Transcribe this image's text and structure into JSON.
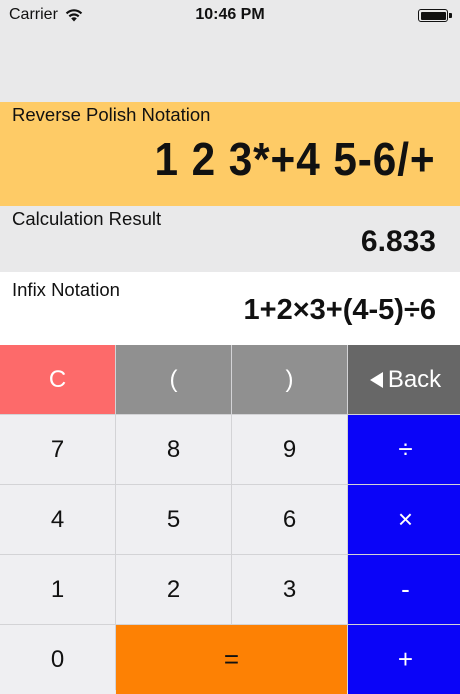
{
  "status_bar": {
    "carrier": "Carrier",
    "time": "10:46 PM",
    "wifi_icon": "wifi-icon",
    "battery_icon": "battery-icon"
  },
  "rpn": {
    "label": "Reverse Polish Notation",
    "value": "1 2 3*+4 5-6/+"
  },
  "result": {
    "label": "Calculation Result",
    "value": "6.833"
  },
  "infix": {
    "label": "Infix Notation",
    "value": "1+2×3+(4-5)÷6"
  },
  "keypad": {
    "clear": "C",
    "open_paren": "(",
    "close_paren": ")",
    "back": "Back",
    "back_icon": "left-triangle-icon",
    "seven": "7",
    "eight": "8",
    "nine": "9",
    "divide": "÷",
    "four": "4",
    "five": "5",
    "six": "6",
    "multiply": "×",
    "one": "1",
    "two": "2",
    "three": "3",
    "minus": "-",
    "zero": "0",
    "equals": "=",
    "plus": "+"
  },
  "colors": {
    "rpn_bg": "#fecb66",
    "clear_key": "#fd6a6a",
    "paren_key": "#909090",
    "back_key": "#676767",
    "operator_key": "#0a04f8",
    "equals_key": "#fd8104",
    "digit_key": "#efeff2"
  }
}
